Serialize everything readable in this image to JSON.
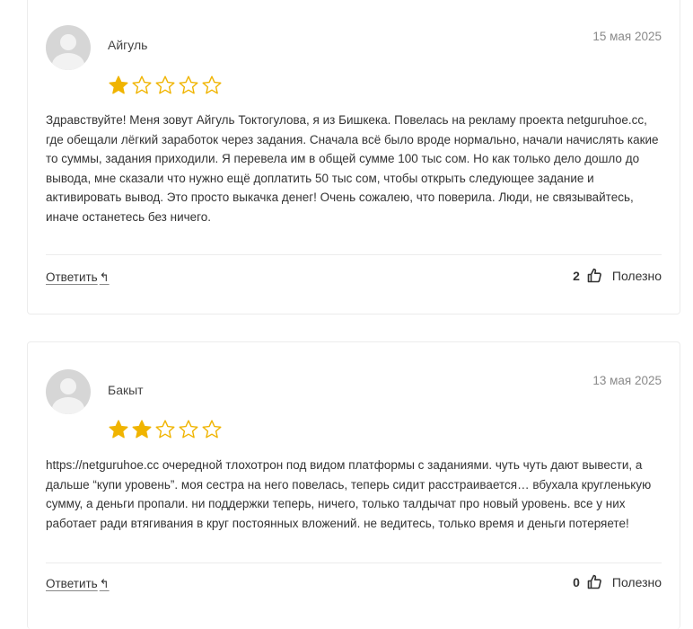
{
  "colors": {
    "star_filled": "#f0b400",
    "star_empty": "#f0b400",
    "text": "#333333",
    "date": "#8a8a8a",
    "border": "#ececec"
  },
  "reviews": [
    {
      "author": "Айгуль",
      "date": "15 мая 2025",
      "rating": 1,
      "max_rating": 5,
      "text": "Здравствуйте! Меня зовут Айгуль Токтогулова, я из Бишкека. Повелась на рекламу проекта netguruhoe.cc, где обещали лёгкий заработок через задания. Сначала всё было вроде нормально, начали начислять какие то суммы, задания приходили. Я перевела им в общей сумме 100 тыс сом. Но как только дело дошло до вывода, мне сказали что нужно ещё доплатить 50 тыс сом, чтобы открыть следующее задание и активировать вывод. Это просто выкачка денег! Очень сожалею, что поверила. Люди, не связывайтесь, иначе останетесь без ничего.",
      "reply_label": "Ответить",
      "reply_icon": "reply-arrow-icon",
      "helpful_count": "2",
      "helpful_label": "Полезно",
      "helpful_icon": "thumbs-up-icon"
    },
    {
      "author": "Бакыт",
      "date": "13 мая 2025",
      "rating": 2,
      "max_rating": 5,
      "text": "https://netguruhoe.cc очередной тлохотрон под видом платформы с заданиями. чуть чуть дают вывести, а дальше “купи уровень”. моя сестра на него повелась, теперь сидит расстраивается… вбухала кругленькую сумму, а деньги пропали. ни поддержки теперь, ничего, только талдычат про новый уровень. все у них работает ради втягивания в круг постоянных вложений. не ведитесь, только время и деньги потеряете!",
      "reply_label": "Ответить",
      "reply_icon": "reply-arrow-icon",
      "helpful_count": "0",
      "helpful_label": "Полезно",
      "helpful_icon": "thumbs-up-icon"
    }
  ]
}
